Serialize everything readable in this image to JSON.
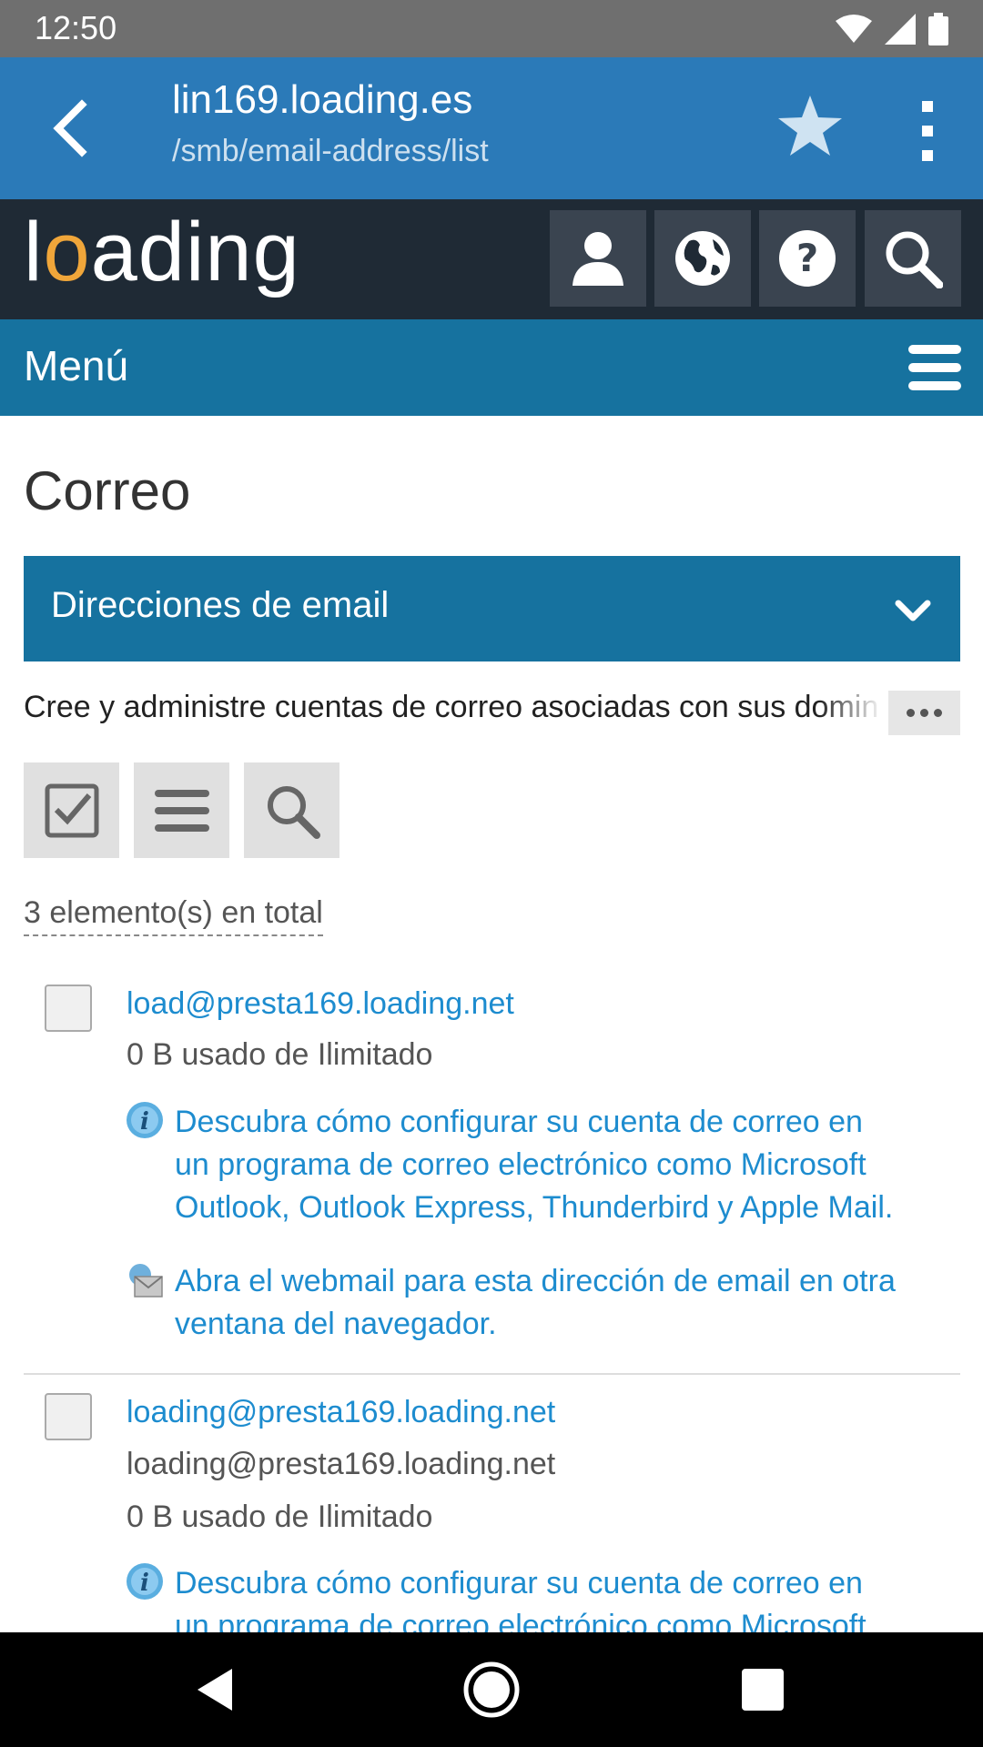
{
  "status_bar": {
    "time": "12:50"
  },
  "browser": {
    "title": "lin169.loading.es",
    "path": "/smb/email-address/list"
  },
  "site": {
    "logo_text": "loading",
    "menu_label": "Menú"
  },
  "main": {
    "page_title": "Correo",
    "section_label": "Direcciones de email",
    "description": "Cree y administre cuentas de correo asociadas con sus dominios",
    "total_label": "3 elemento(s) en total"
  },
  "items": [
    {
      "email": "load@presta169.loading.net",
      "usage": "0 B usado de Ilimitado",
      "help_line1": "Descubra cómo configurar su cuenta de correo en",
      "help_line2": "un programa de correo electrónico como Microsoft",
      "help_line3": "Outlook, Outlook Express, Thunderbird y Apple Mail.",
      "webmail_line1": "Abra el webmail para esta dirección de email en otra",
      "webmail_line2": "ventana del navegador."
    },
    {
      "email": "loading@presta169.loading.net",
      "alias": "loading@presta169.loading.net",
      "usage": "0 B usado de Ilimitado",
      "help_line1": "Descubra cómo configurar su cuenta de correo en",
      "help_line2": "un programa de correo electrónico como Microsoft"
    }
  ],
  "colors": {
    "toolbar": "#2b7ab8",
    "header": "#1f2a35",
    "accent": "#16729f",
    "link": "#1d8ccf",
    "logo_o": "#f0a63a"
  },
  "icons": [
    "back-arrow-icon",
    "star-icon",
    "more-vert-icon",
    "user-icon",
    "globe-icon",
    "help-icon",
    "search-icon",
    "hamburger-icon",
    "chevron-down-icon",
    "checkbox-icon",
    "list-icon",
    "info-icon",
    "webmail-icon"
  ]
}
